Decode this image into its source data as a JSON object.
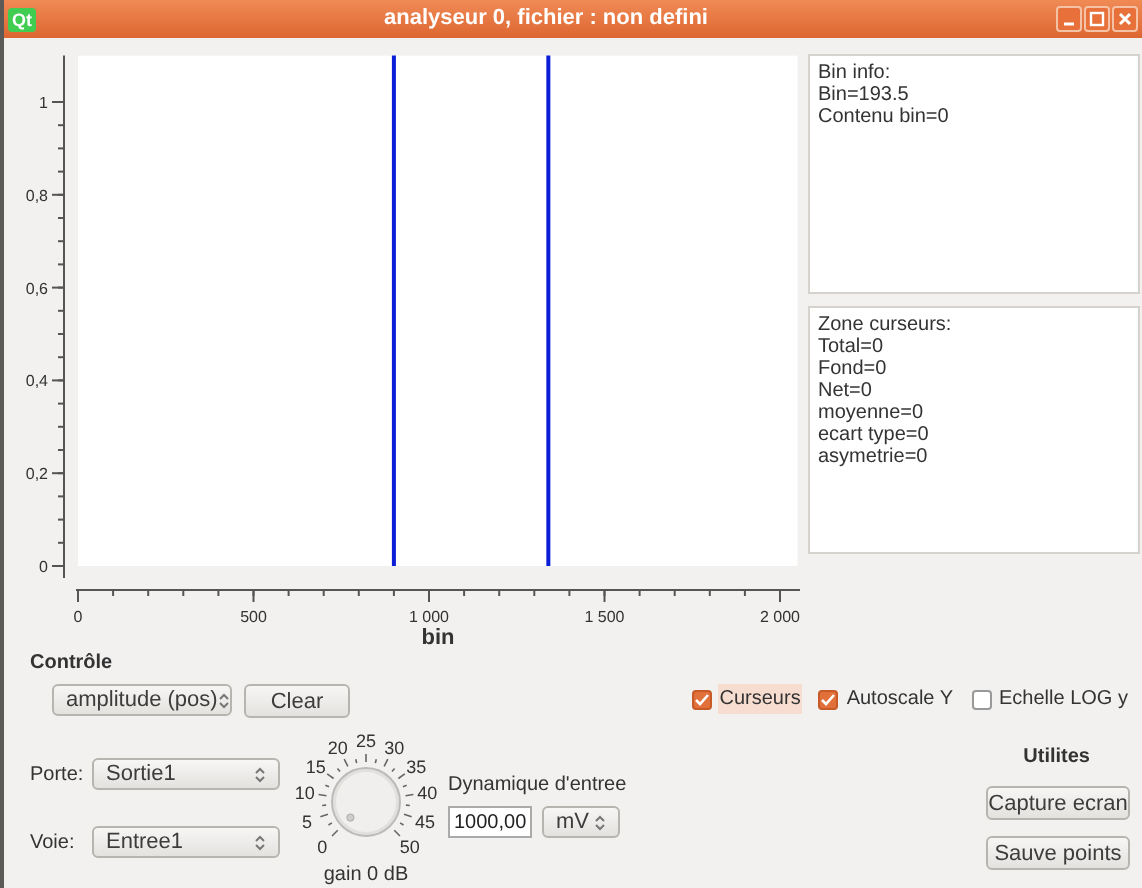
{
  "window": {
    "logo": "Qt",
    "title": "analyseur 0, fichier : non defini",
    "buttons": [
      {
        "kind": "minimize"
      },
      {
        "kind": "maximize"
      },
      {
        "kind": "close"
      }
    ]
  },
  "chart": {
    "chart_data": {
      "type": "line",
      "xlabel": "bin",
      "xlim": [
        0,
        2050
      ],
      "ylim": [
        0,
        1.1
      ],
      "xticks": [
        {
          "value": 0,
          "label": "0"
        },
        {
          "value": 500,
          "label": "500"
        },
        {
          "value": 1000,
          "label": "1 000"
        },
        {
          "value": 1500,
          "label": "1 500"
        },
        {
          "value": 2000,
          "label": "2 000"
        }
      ],
      "yticks": [
        {
          "value": 0,
          "label": "0"
        },
        {
          "value": 0.2,
          "label": "0,2"
        },
        {
          "value": 0.4,
          "label": "0,4"
        },
        {
          "value": 0.6,
          "label": "0,6"
        },
        {
          "value": 0.8,
          "label": "0,8"
        },
        {
          "value": 1,
          "label": "1"
        }
      ],
      "ref_lines": [
        {
          "axis": "x",
          "value": 900,
          "color": "#0a1ed8"
        },
        {
          "axis": "x",
          "value": 1340,
          "color": "#0a1ed8"
        }
      ]
    }
  },
  "bin_info": {
    "lines": [
      "Bin info:",
      "Bin=193.5",
      "Contenu bin=0"
    ]
  },
  "zone_curseurs": {
    "lines": [
      "Zone curseurs:",
      "Total=0",
      "Fond=0",
      "Net=0",
      "moyenne=0",
      "ecart type=0",
      "asymetrie=0"
    ]
  },
  "controle": {
    "title": "Contrôle",
    "mode_select": "amplitude (pos)",
    "clear_button": "Clear"
  },
  "checkboxes": [
    {
      "label": "Curseurs",
      "checked": true,
      "focused": true
    },
    {
      "label": "Autoscale Y",
      "checked": true,
      "focused": false
    },
    {
      "label": "Echelle LOG y",
      "checked": false,
      "focused": false
    }
  ],
  "porte": {
    "label": "Porte:",
    "value": "Sortie1"
  },
  "voie": {
    "label": "Voie:",
    "value": "Entree1"
  },
  "gain_knob": {
    "left_labels": [
      "20",
      "15",
      "10",
      "5",
      "0"
    ],
    "top_label": "25",
    "right_labels": [
      "30",
      "35",
      "40",
      "45",
      "50"
    ],
    "caption": "gain 0 dB"
  },
  "dynamique": {
    "label": "Dynamique d'entree",
    "value": "1000,00",
    "unit": "mV"
  },
  "utilites": {
    "title": "Utilites",
    "buttons": [
      "Capture ecran",
      "Sauve points"
    ]
  }
}
